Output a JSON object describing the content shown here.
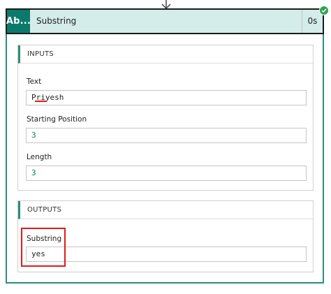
{
  "action": {
    "badge": "Ab...",
    "title": "Substring",
    "duration": "0s",
    "status": "succeeded"
  },
  "inputs": {
    "heading": "INPUTS",
    "fields": [
      {
        "label": "Text",
        "value": "Priyesh"
      },
      {
        "label": "Starting Position",
        "value": "3"
      },
      {
        "label": "Length",
        "value": "3"
      }
    ]
  },
  "outputs": {
    "heading": "OUTPUTS",
    "fields": [
      {
        "label": "Substring",
        "value": "yes"
      }
    ]
  },
  "colors": {
    "accent": "#0b7a6b",
    "header_bg": "#d4ecea",
    "number_value": "#098658",
    "annotation": "#e01b1b",
    "success": "#2ea44f"
  }
}
